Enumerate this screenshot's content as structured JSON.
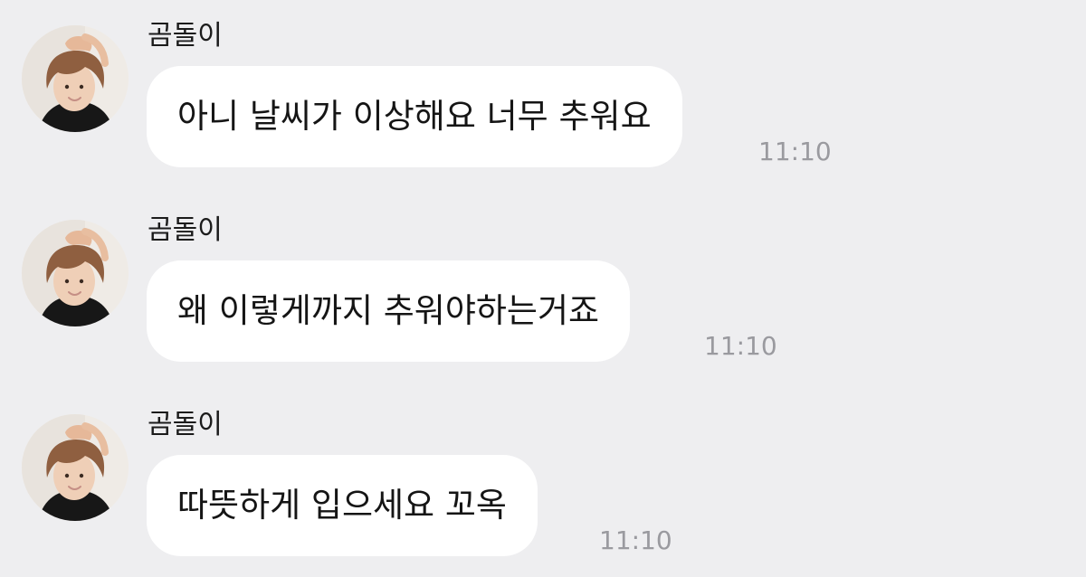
{
  "chat": {
    "messages": [
      {
        "sender": "곰돌이",
        "text": "아니 날씨가 이상해요 너무 추워요",
        "time": "11:10",
        "avatar_icon": "profile-avatar-icon"
      },
      {
        "sender": "곰돌이",
        "text": "왜 이렇게까지 추워야하는거죠",
        "time": "11:10",
        "avatar_icon": "profile-avatar-icon"
      },
      {
        "sender": "곰돌이",
        "text": "따뜻하게 입으세요 꼬옥",
        "time": "11:10",
        "avatar_icon": "profile-avatar-icon"
      }
    ]
  },
  "colors": {
    "background": "#eeeef0",
    "bubble": "#ffffff",
    "timestamp": "#9a9a9f"
  }
}
